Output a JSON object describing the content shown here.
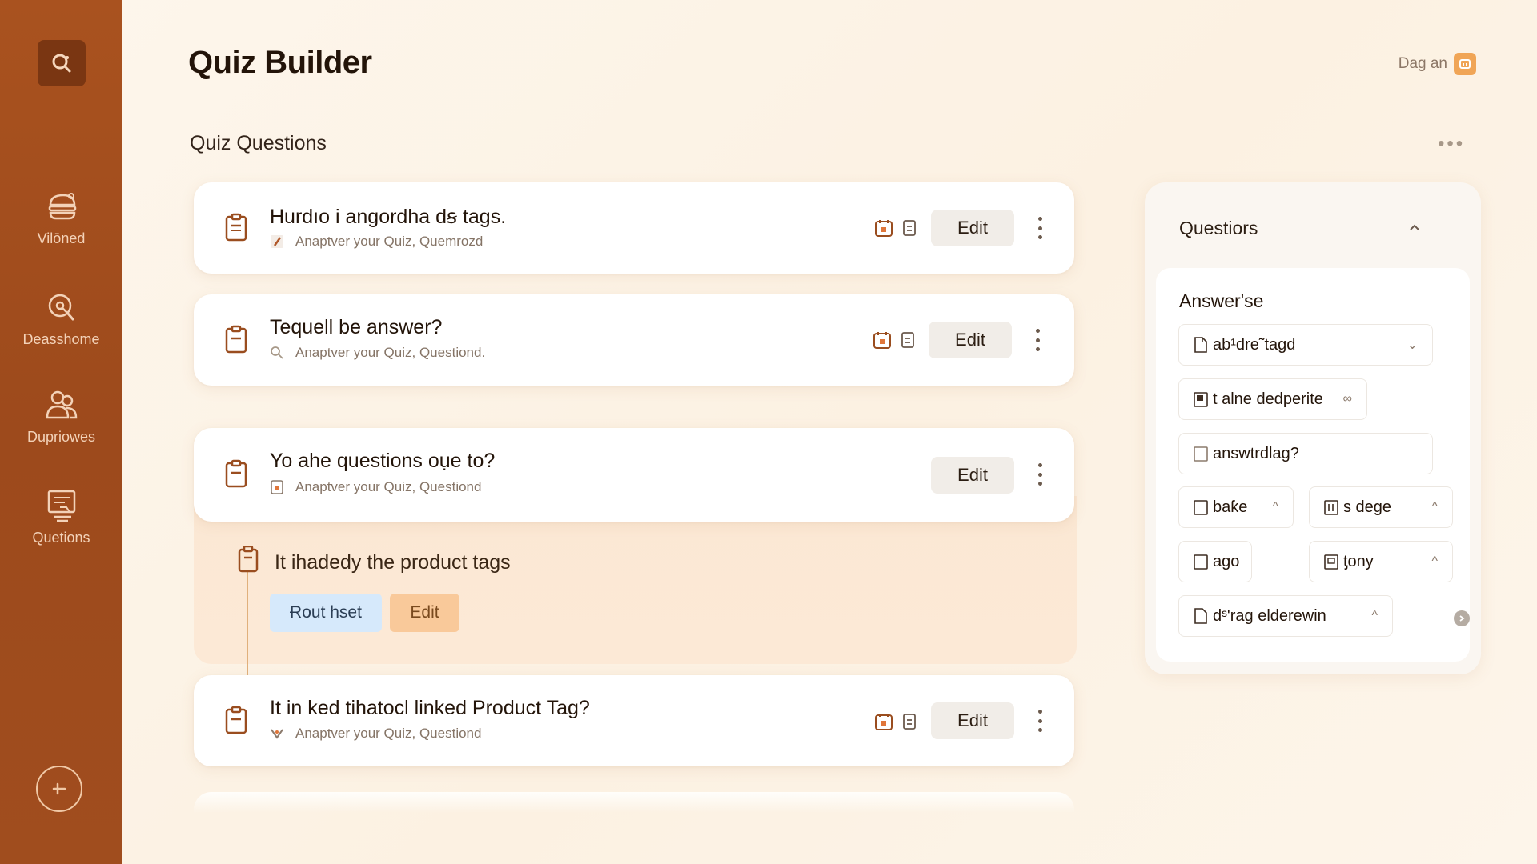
{
  "app": {
    "title": "Quiz Builder",
    "user_label": "Dag an"
  },
  "sidebar": {
    "items": [
      {
        "label": "Vilōned",
        "icon": "burger-icon"
      },
      {
        "label": "Deasshome",
        "icon": "dashboard-search-icon"
      },
      {
        "label": "Dupriowes",
        "icon": "users-icon"
      },
      {
        "label": "Quetions",
        "icon": "questions-icon"
      }
    ]
  },
  "section": {
    "title": "Quiz Questions",
    "more": "•••"
  },
  "questions": [
    {
      "title": "Hurdıo i angordha dꞩ tags.",
      "subtitle": "Anaptver your Quiz, Quemrozd",
      "edit_label": "Edit"
    },
    {
      "title": "Tequell be answer?",
      "subtitle": "Anaptver your Quiz, Questiond.",
      "edit_label": "Edit"
    },
    {
      "title": "Yo ahe questions oụe to?",
      "subtitle": "Anaptver your Quiz, Questiond",
      "edit_label": "Edit"
    },
    {
      "title": "It in ked tihatocl linked Product Tag?",
      "subtitle": "Anaptver your Quiz, Questiond",
      "edit_label": "Edit"
    }
  ],
  "expanded": {
    "title": "It ihadedy the product tags",
    "tag_button": "Ɍout hset",
    "edit_label": "Edit"
  },
  "panel": {
    "title": "Questiors",
    "subtitle": "Answer'se",
    "chips": [
      {
        "label": "ab¹dre˜tagd",
        "suffix": "⌄"
      },
      {
        "label": "t alne dedperite",
        "suffix": "∞"
      },
      {
        "label": "answtrdlag?",
        "suffix": ""
      },
      {
        "label": "baƙe",
        "suffix": "^"
      },
      {
        "label": "s dege",
        "suffix": "^"
      },
      {
        "label": "ago",
        "suffix": ""
      },
      {
        "label": "ƫony",
        "suffix": "^"
      },
      {
        "label": "dˢ'rag elderewin",
        "suffix": "^"
      }
    ]
  },
  "colors": {
    "sidebar": "#a9521f",
    "accent": "#f0a556",
    "tag_blue": "#d6e9fb",
    "tag_orange": "#f9c99a"
  }
}
